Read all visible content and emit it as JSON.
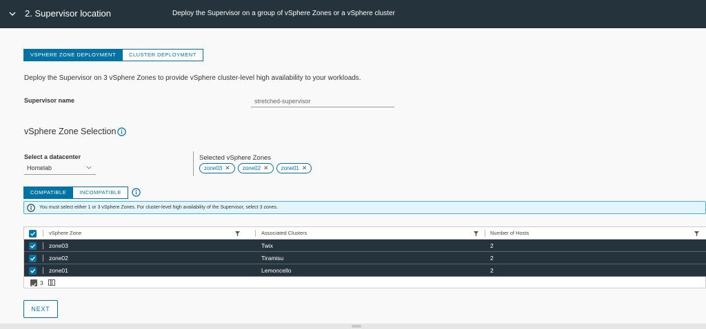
{
  "header": {
    "step_label": "2.   Supervisor location",
    "description": "Deploy the Supervisor on a group of vSphere Zones or a vSphere cluster"
  },
  "deployment_tabs": {
    "zone": "VSPHERE ZONE DEPLOYMENT",
    "cluster": "CLUSTER DEPLOYMENT",
    "active": "zone"
  },
  "intro_text": "Deploy the Supervisor on 3 vSphere Zones to provide vSphere cluster-level high availability to your workloads.",
  "supervisor": {
    "label": "Supervisor name",
    "value": "stretched-supervisor"
  },
  "zone_selection": {
    "title": "vSphere Zone Selection"
  },
  "datacenter": {
    "label": "Select a datacenter",
    "value": "Homelab"
  },
  "selected_zones": {
    "title": "Selected vSphere Zones",
    "chips": [
      "zone03",
      "zone02",
      "zone01"
    ]
  },
  "compat_tabs": {
    "compatible": "COMPATIBLE",
    "incompatible": "INCOMPATIBLE",
    "active": "compatible"
  },
  "alert": {
    "text": "You must select either 1 or 3 vSphere Zones. For cluster-level high availability of the Supervisor, select 3 zones."
  },
  "grid": {
    "columns": [
      "vSphere Zone",
      "Associated Clusters",
      "Number of Hosts"
    ],
    "rows": [
      {
        "zone": "zone03",
        "cluster": "Twix",
        "hosts": "2",
        "selected": true
      },
      {
        "zone": "zone02",
        "cluster": "Tiramisu",
        "hosts": "2",
        "selected": true
      },
      {
        "zone": "zone01",
        "cluster": "Lemoncello",
        "hosts": "2",
        "selected": true
      }
    ],
    "selected_count": "3"
  },
  "next_label": "NEXT",
  "colors": {
    "header_bg": "#25333d",
    "accent": "#0072a3",
    "alert_bg": "#e3f5fc",
    "selected_row_bg": "#25333d"
  }
}
